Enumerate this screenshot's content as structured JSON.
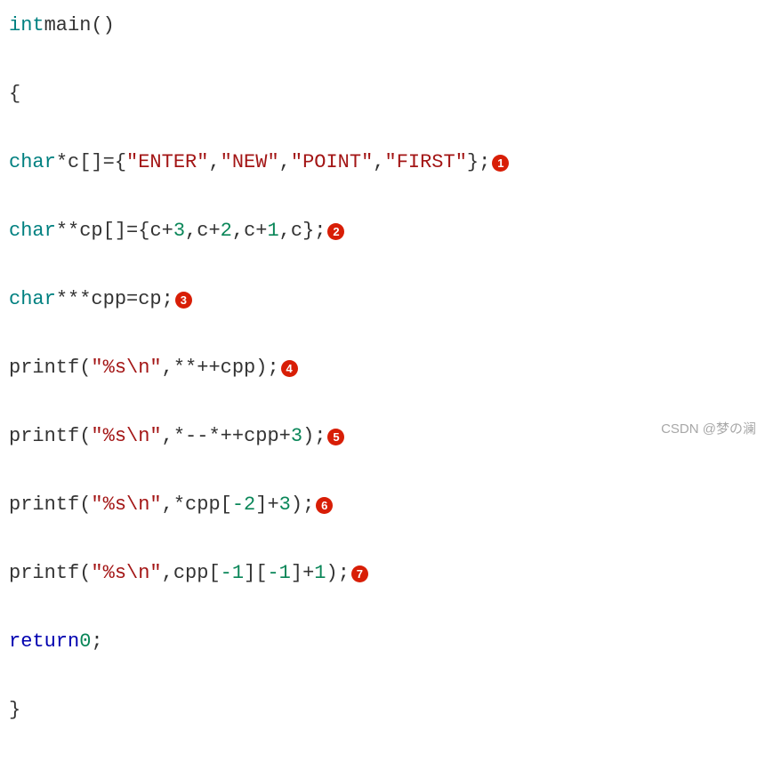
{
  "cut_text": "",
  "tokens": {
    "int": "int",
    "main": "main",
    "lp": "(",
    "rp": ")",
    "ob": "{",
    "cb": "}",
    "semi": ";",
    ".sp": " ",
    "char": "char",
    "star": "*",
    "c": "c",
    "lbr": "[",
    "rbr": "]",
    "eq": "=",
    "comma": ",",
    "ENTER": "\"ENTER\"",
    "NEW": "\"NEW\"",
    "POINT": "\"POINT\"",
    "FIRST": "\"FIRST\"",
    "plus": "+",
    "cp": "cp",
    "cpp": "cpp",
    "printf": "printf",
    "fmtstr": "\"%s\\n\"",
    "pp": "++",
    "mm": "--",
    "n1": "1",
    "n2": "2",
    "n3": "3",
    "neg1": "-1",
    "neg2": "-2",
    "return": "return",
    "zero": "0"
  },
  "labels": {
    "l1": "1",
    "l2": "2",
    "l3": "3",
    "l4": "4",
    "l5": "5",
    "l6": "6",
    "l7": "7"
  },
  "watermark": "CSDN @梦の澜"
}
